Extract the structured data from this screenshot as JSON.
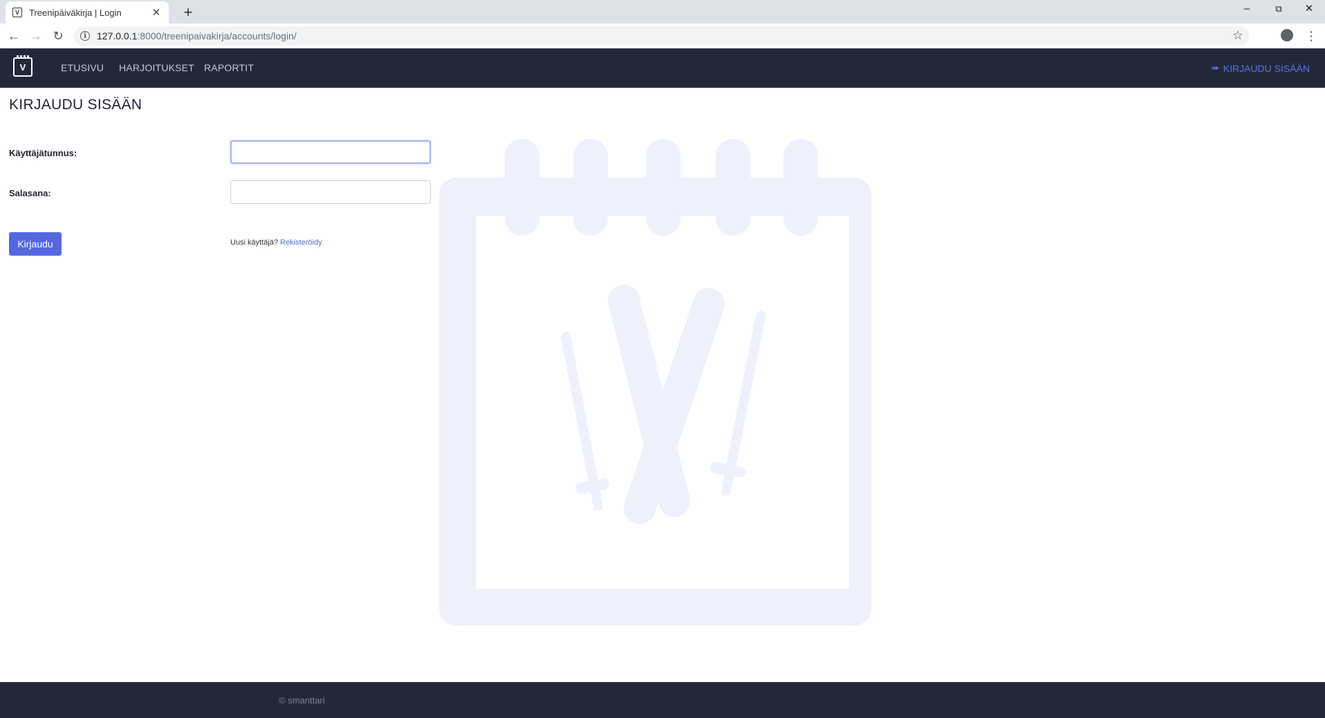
{
  "browser": {
    "tab_title": "Treenipäiväkirja | Login",
    "url_host": "127.0.0.1",
    "url_rest": ":8000/treenipaivakirja/accounts/login/"
  },
  "nav": {
    "brand_icon": "calendar-ski-logo",
    "items": [
      {
        "label": "ETUSIVU"
      },
      {
        "label": "HARJOITUKSET"
      },
      {
        "label": "RAPORTIT"
      }
    ],
    "login_label": "KIRJAUDU SISÄÄN"
  },
  "page": {
    "title": "KIRJAUDU SISÄÄN",
    "username_label": "Käyttäjätunnus:",
    "username_value": "",
    "password_label": "Salasana:",
    "password_value": "",
    "submit_label": "Kirjaudu",
    "new_user_text": "Uusi käyttäjä?",
    "register_label": "Rekisteröidy"
  },
  "footer": {
    "text": "© smanttari"
  },
  "colors": {
    "navbar_bg": "#232839",
    "accent": "#5468de",
    "watermark": "#eef0fc"
  }
}
